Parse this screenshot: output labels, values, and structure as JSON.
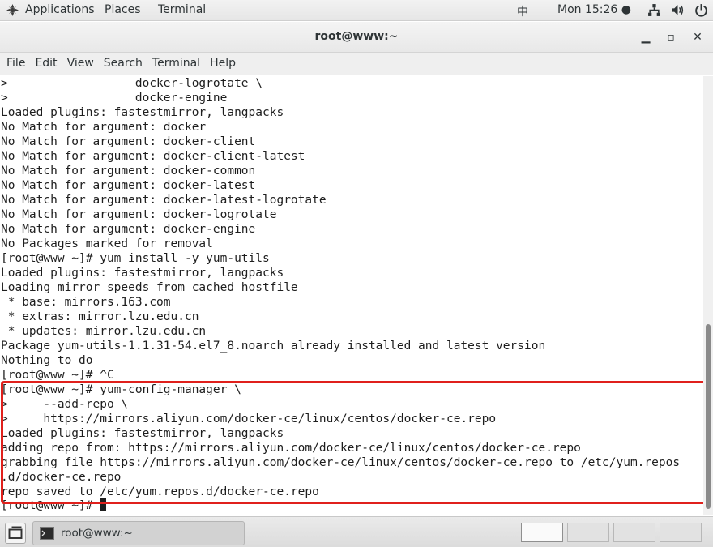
{
  "topbar": {
    "applications": "Applications",
    "places": "Places",
    "terminal": "Terminal",
    "input_method": "中",
    "clock": "Mon 15:26 ●",
    "icons": [
      "network-icon",
      "volume-icon",
      "power-icon"
    ]
  },
  "window": {
    "title": "root@www:~",
    "minimize": "▁",
    "maximize": "▫",
    "close": "✕"
  },
  "menubar": {
    "file": "File",
    "edit": "Edit",
    "view": "View",
    "search": "Search",
    "terminal": "Terminal",
    "help": "Help"
  },
  "terminal": {
    "lines": [
      ">                  docker-logrotate \\",
      ">                  docker-engine",
      "Loaded plugins: fastestmirror, langpacks",
      "No Match for argument: docker",
      "No Match for argument: docker-client",
      "No Match for argument: docker-client-latest",
      "No Match for argument: docker-common",
      "No Match for argument: docker-latest",
      "No Match for argument: docker-latest-logrotate",
      "No Match for argument: docker-logrotate",
      "No Match for argument: docker-engine",
      "No Packages marked for removal",
      "[root@www ~]# yum install -y yum-utils",
      "Loaded plugins: fastestmirror, langpacks",
      "Loading mirror speeds from cached hostfile",
      " * base: mirrors.163.com",
      " * extras: mirror.lzu.edu.cn",
      " * updates: mirror.lzu.edu.cn",
      "Package yum-utils-1.1.31-54.el7_8.noarch already installed and latest version",
      "Nothing to do",
      "[root@www ~]# ^C",
      "[root@www ~]# yum-config-manager \\",
      ">     --add-repo \\",
      ">     https://mirrors.aliyun.com/docker-ce/linux/centos/docker-ce.repo",
      "Loaded plugins: fastestmirror, langpacks",
      "adding repo from: https://mirrors.aliyun.com/docker-ce/linux/centos/docker-ce.repo",
      "grabbing file https://mirrors.aliyun.com/docker-ce/linux/centos/docker-ce.repo to /etc/yum.repos",
      ".d/docker-ce.repo",
      "repo saved to /etc/yum.repos.d/docker-ce.repo"
    ],
    "prompt": "[root@www ~]# ",
    "highlight_color": "#e0201c"
  },
  "taskbar": {
    "task_label": "root@www:~",
    "workspaces": 4,
    "active_workspace": 1
  }
}
